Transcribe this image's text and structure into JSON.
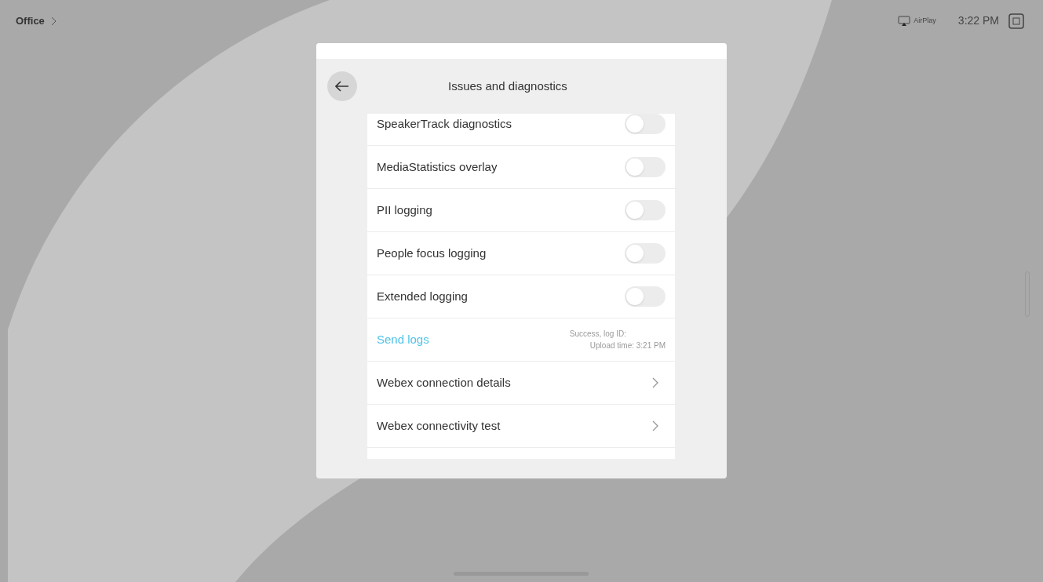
{
  "top_bar": {
    "location": "Office",
    "airplay_label": "AirPlay",
    "time": "3:22 PM"
  },
  "panel": {
    "title": "Issues and diagnostics",
    "rows": [
      {
        "kind": "toggle",
        "label": "SpeakerTrack diagnostics",
        "on": false
      },
      {
        "kind": "toggle",
        "label": "MediaStatistics overlay",
        "on": false
      },
      {
        "kind": "toggle",
        "label": "PII logging",
        "on": false
      },
      {
        "kind": "toggle",
        "label": "People focus logging",
        "on": false
      },
      {
        "kind": "toggle",
        "label": "Extended logging",
        "on": false
      },
      {
        "kind": "action",
        "label": "Send logs",
        "status": [
          "Success, log ID:",
          "Upload time: 3:21 PM"
        ]
      },
      {
        "kind": "link",
        "label": "Webex connection details"
      },
      {
        "kind": "link",
        "label": "Webex connectivity test"
      }
    ]
  }
}
